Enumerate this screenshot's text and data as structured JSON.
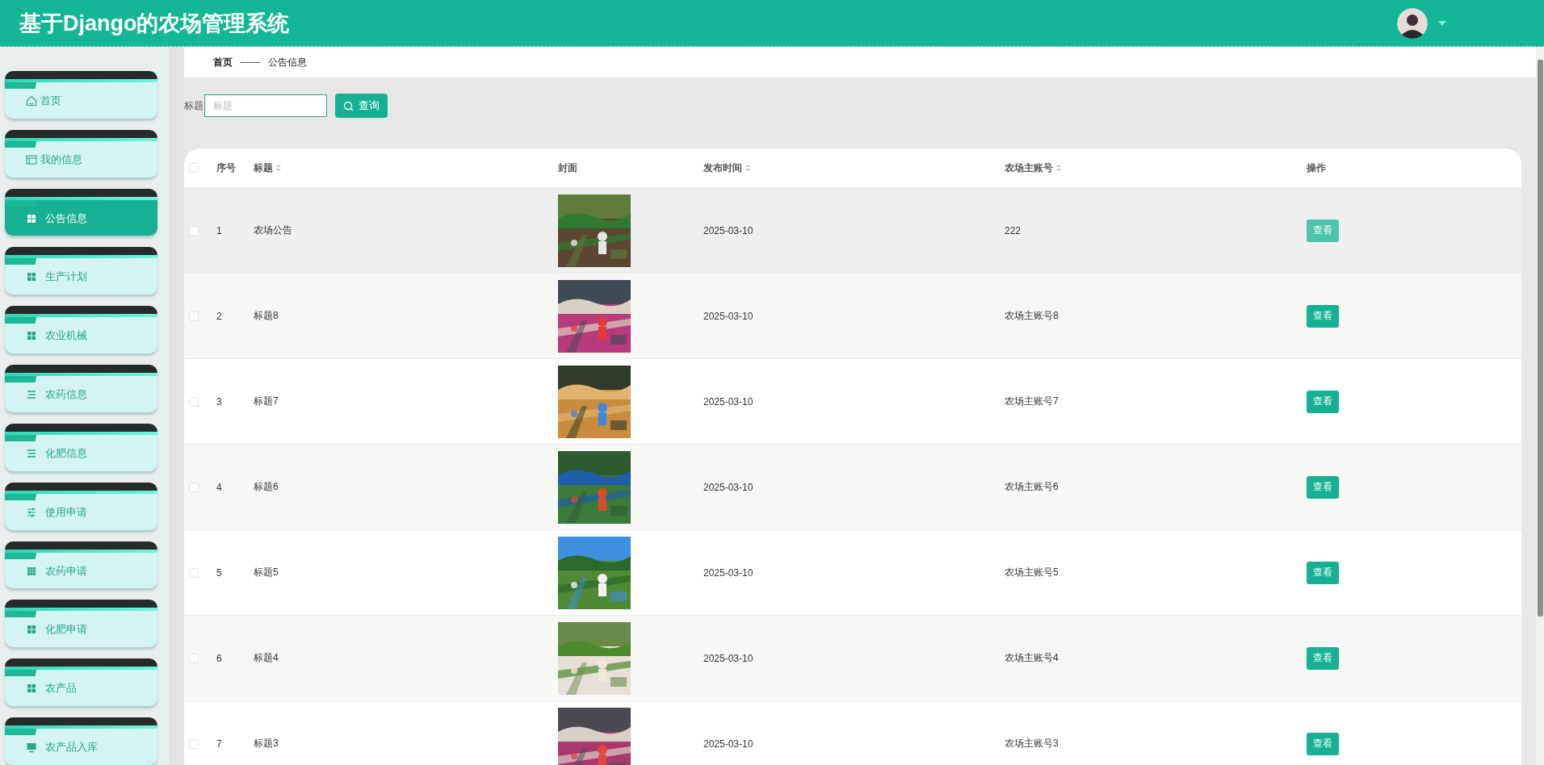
{
  "header": {
    "title": "基于Django的农场管理系统"
  },
  "sidebar": {
    "items": [
      {
        "label": "首页",
        "kind": "home",
        "selected": false
      },
      {
        "label": "我的信息",
        "kind": "profile",
        "selected": false
      },
      {
        "label": "公告信息",
        "kind": "grid",
        "selected": true
      },
      {
        "label": "生产计划",
        "kind": "grid",
        "selected": false
      },
      {
        "label": "农业机械",
        "kind": "grid",
        "selected": false
      },
      {
        "label": "农药信息",
        "kind": "list",
        "selected": false
      },
      {
        "label": "化肥信息",
        "kind": "list",
        "selected": false
      },
      {
        "label": "使用申请",
        "kind": "sliders",
        "selected": false
      },
      {
        "label": "农药申请",
        "kind": "apps",
        "selected": false
      },
      {
        "label": "化肥申请",
        "kind": "grid",
        "selected": false
      },
      {
        "label": "农产品",
        "kind": "grid",
        "selected": false
      },
      {
        "label": "农产品入库",
        "kind": "monitor",
        "selected": false
      }
    ]
  },
  "breadcrumb": [
    "首页",
    "——",
    "公告信息"
  ],
  "search": {
    "label": "标题",
    "placeholder": "标题",
    "button": "查询"
  },
  "table": {
    "select_all": {
      "checked": false
    },
    "columns": [
      {
        "label": "序号",
        "sortable": false
      },
      {
        "label": "标题",
        "sortable": true
      },
      {
        "label": "封面",
        "sortable": false
      },
      {
        "label": "发布时间",
        "sortable": true
      },
      {
        "label": "农场主账号",
        "sortable": true
      },
      {
        "label": "操作",
        "sortable": false
      }
    ],
    "rows": [
      {
        "index": "1",
        "title": "农场公告",
        "date": "2025-03-10",
        "account": "222",
        "action": "查看",
        "hovered": true
      },
      {
        "index": "2",
        "title": "标题8",
        "date": "2025-03-10",
        "account": "农场主账号8",
        "action": "查看",
        "hovered": false
      },
      {
        "index": "3",
        "title": "标题7",
        "date": "2025-03-10",
        "account": "农场主账号7",
        "action": "查看",
        "hovered": false
      },
      {
        "index": "4",
        "title": "标题6",
        "date": "2025-03-10",
        "account": "农场主账号6",
        "action": "查看",
        "hovered": false
      },
      {
        "index": "5",
        "title": "标题5",
        "date": "2025-03-10",
        "account": "农场主账号5",
        "action": "查看",
        "hovered": false
      },
      {
        "index": "6",
        "title": "标题4",
        "date": "2025-03-10",
        "account": "农场主账号4",
        "action": "查看",
        "hovered": false
      },
      {
        "index": "7",
        "title": "标题3",
        "date": "2025-03-10",
        "account": "农场主账号3",
        "action": "查看",
        "hovered": false
      }
    ]
  }
}
